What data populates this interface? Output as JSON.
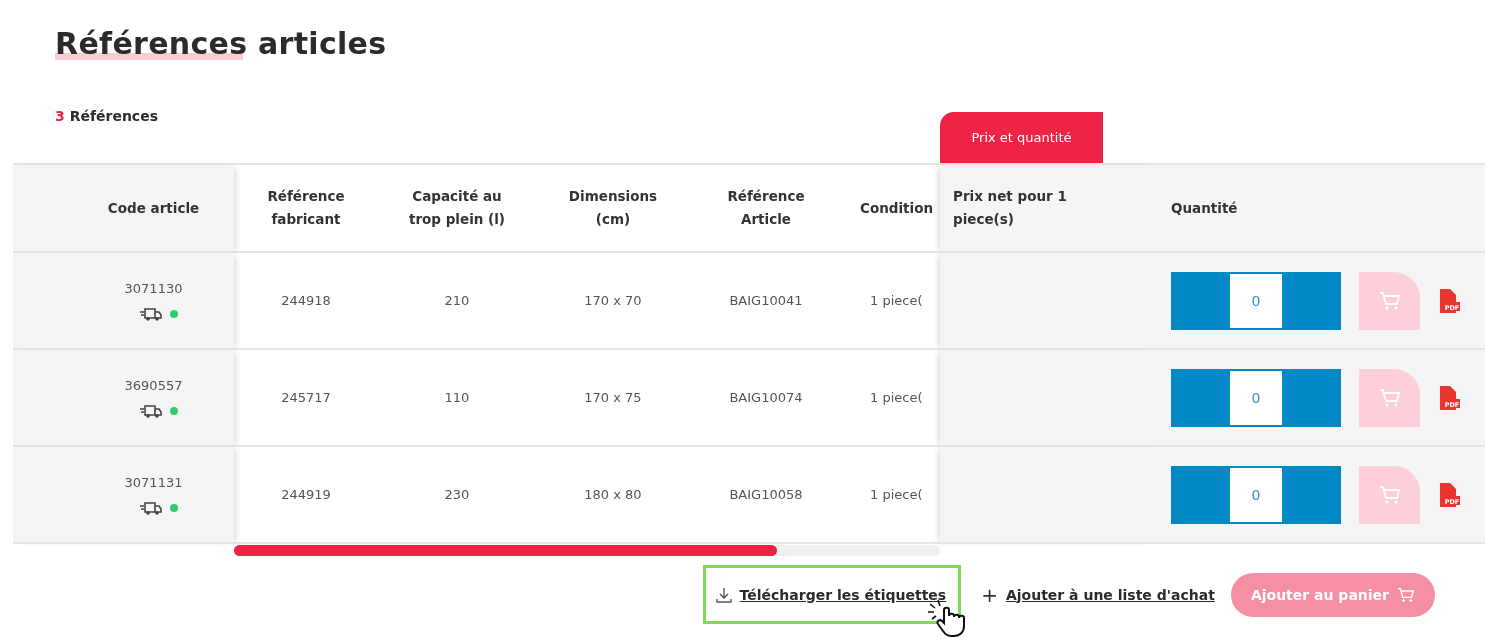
{
  "page_title": "Références articles",
  "count": {
    "number": "3",
    "label": "Références"
  },
  "tab": {
    "label": "Prix et quantité",
    "selected": true
  },
  "columns": [
    "Code article",
    "Référence fabricant",
    "Capacité au trop plein (l)",
    "Dimensions (cm)",
    "Référence Article",
    "Condition",
    "Prix net pour 1 piece(s)",
    "Quantité"
  ],
  "rows": [
    {
      "code": "3071130",
      "in_stock": true,
      "ref_fabricant": "244918",
      "capacite": "210",
      "dimensions": "170 x 70",
      "ref_article": "BAIG10041",
      "conditionnement": "1 piece(",
      "quantity": "0",
      "cart_disabled": true,
      "pdf": "PDF"
    },
    {
      "code": "3690557",
      "in_stock": true,
      "ref_fabricant": "245717",
      "capacite": "110",
      "dimensions": "170 x 75",
      "ref_article": "BAIG10074",
      "conditionnement": "1 piece(",
      "quantity": "0",
      "cart_disabled": true,
      "pdf": "PDF"
    },
    {
      "code": "3071131",
      "in_stock": true,
      "ref_fabricant": "244919",
      "capacite": "230",
      "dimensions": "180 x 80",
      "ref_article": "BAIG10058",
      "conditionnement": "1 piece(",
      "quantity": "0",
      "cart_disabled": true,
      "pdf": "PDF"
    }
  ],
  "actions": {
    "download": {
      "label": "Télécharger les étiquettes",
      "highlighted": true
    },
    "add_list": {
      "icon": "+",
      "label": "Ajouter à une liste d'achat"
    },
    "add_cart": {
      "label": "Ajouter au panier",
      "disabled": true
    }
  }
}
